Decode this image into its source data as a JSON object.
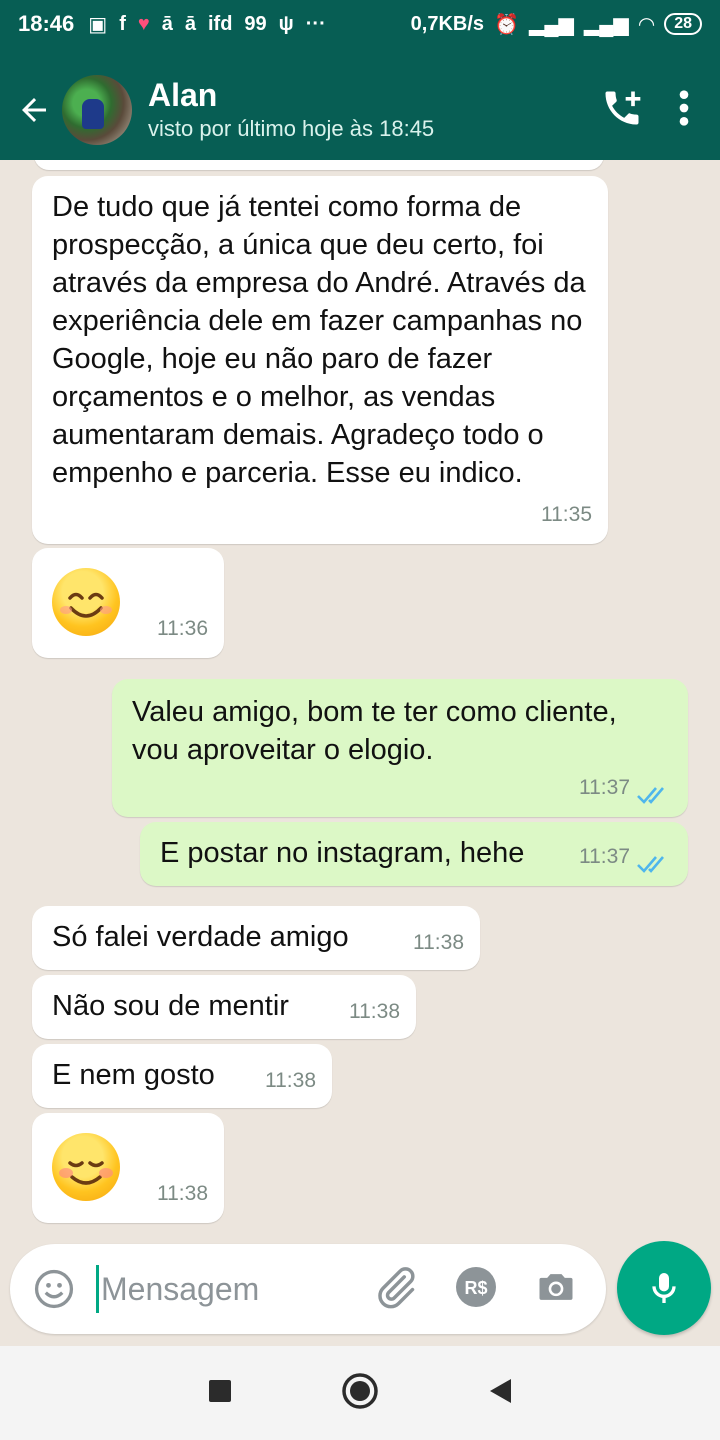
{
  "status_bar": {
    "time": "18:46",
    "net_speed": "0,7KB/s",
    "battery": "28"
  },
  "header": {
    "contact_name": "Alan",
    "last_seen": "visto por último hoje às 18:45"
  },
  "messages": [
    {
      "type": "in",
      "text": "De tudo que já tentei como forma de prospecção, a única que deu certo, foi através da empresa do André. Através da experiência dele em fazer campanhas no Google, hoje eu não paro de fazer orçamentos e o melhor, as vendas aumentaram demais. Agradeço todo o empenho e parceria. Esse eu indico.",
      "time": "11:35"
    },
    {
      "type": "in",
      "text": "😊",
      "time": "11:36"
    },
    {
      "type": "out",
      "text": "Valeu amigo, bom te ter como cliente, vou aproveitar o elogio.",
      "time": "11:37"
    },
    {
      "type": "out",
      "text": "E postar no instagram, hehe",
      "time": "11:37"
    },
    {
      "type": "in",
      "text": "Só falei verdade amigo",
      "time": "11:38"
    },
    {
      "type": "in",
      "text": "Não sou de mentir",
      "time": "11:38"
    },
    {
      "type": "in",
      "text": "E nem gosto",
      "time": "11:38"
    },
    {
      "type": "in",
      "text": "☺️",
      "time": "11:38"
    }
  ],
  "composer": {
    "placeholder": "Mensagem"
  },
  "colors": {
    "header": "#075e54",
    "accent": "#00a884",
    "outgoing_bubble": "#dcf8c6",
    "incoming_bubble": "#ffffff",
    "read_ticks": "#4fb6ec"
  }
}
